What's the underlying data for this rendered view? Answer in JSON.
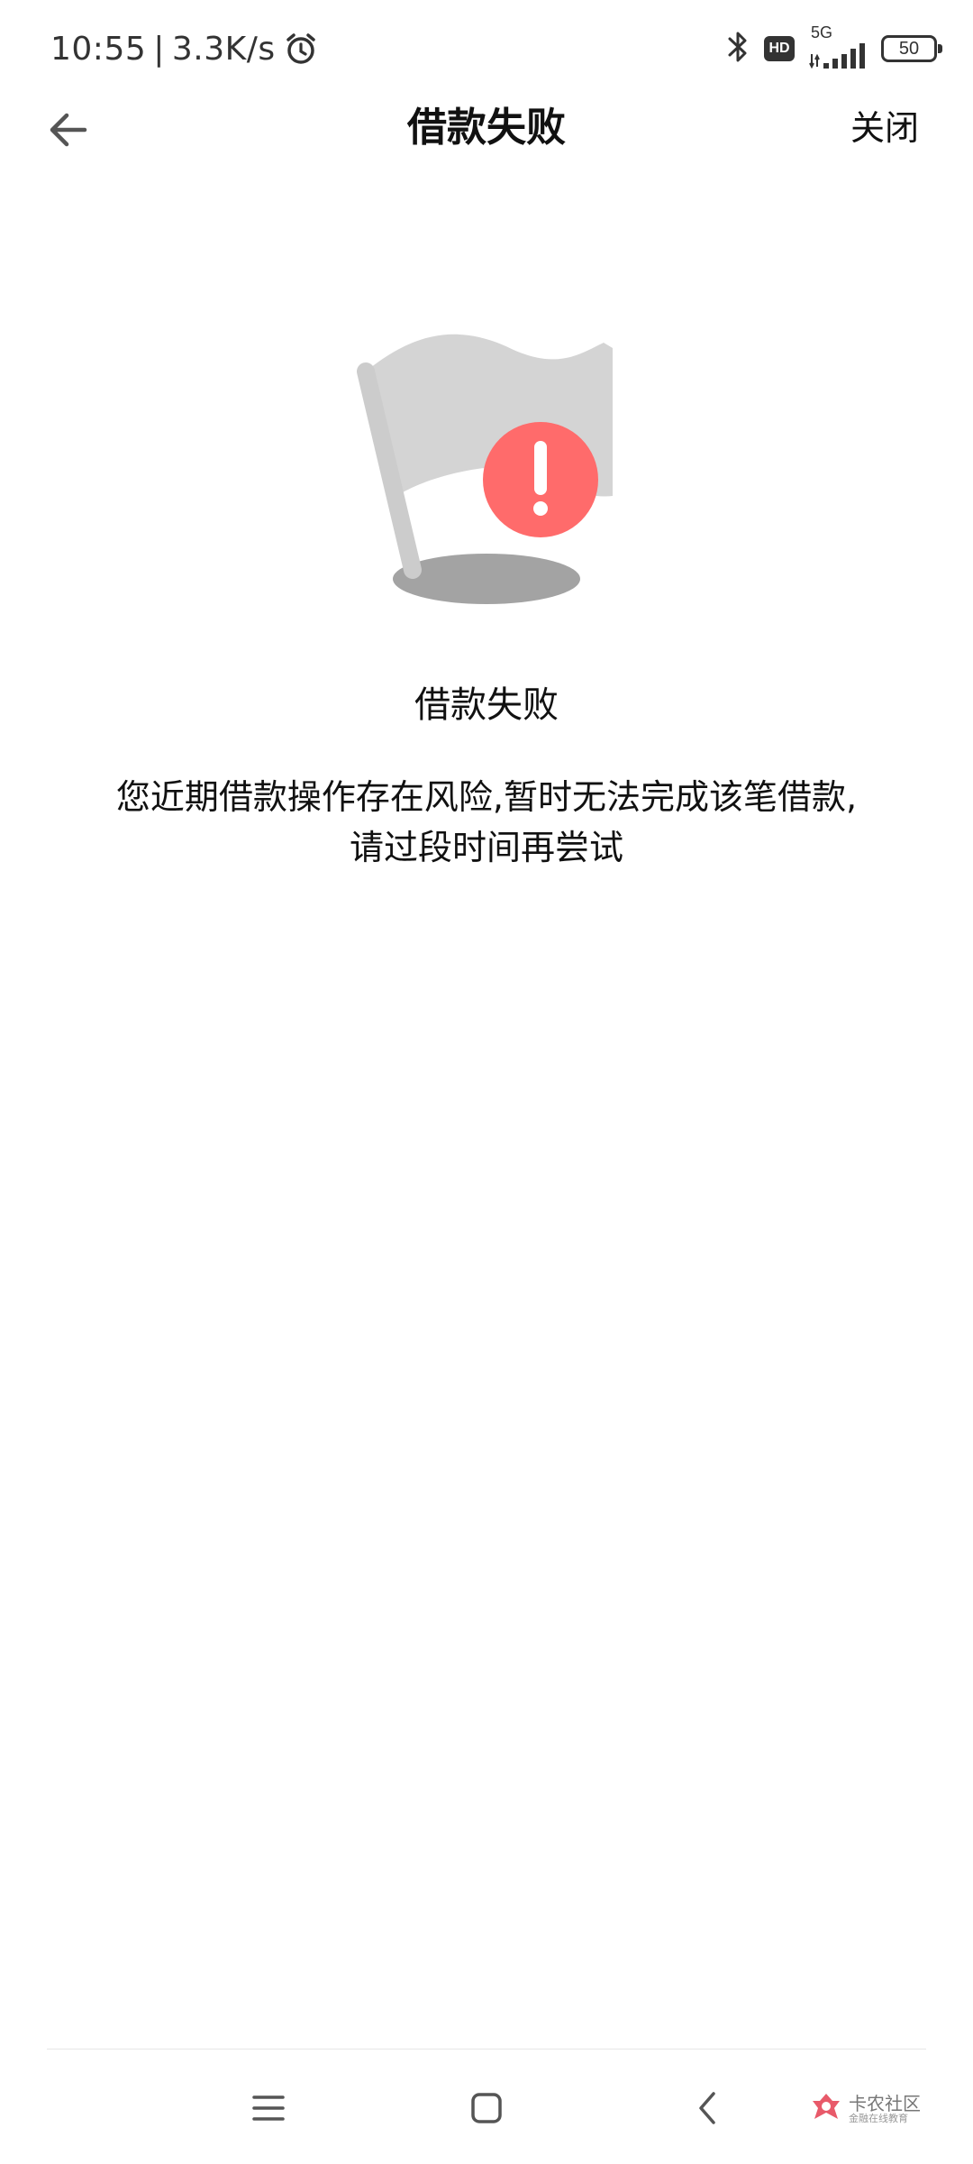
{
  "status_bar": {
    "time": "10:55",
    "separator": "|",
    "net_speed": "3.3K/s",
    "network_type": "5G",
    "hd_label": "HD",
    "battery_level": "50",
    "icons": [
      "alarm-icon",
      "bluetooth-icon",
      "hd-icon",
      "signal-icon",
      "battery-icon"
    ]
  },
  "header": {
    "title": "借款失败",
    "close_label": "关闭",
    "back_icon": "back-arrow-icon"
  },
  "result": {
    "icon": "failure-flag-icon",
    "accent_color": "#ff6b6b",
    "title": "借款失败",
    "message_line1": "您近期借款操作存在风险,暂时无法完成该笔借款,",
    "message_line2": "请过段时间再尝试"
  },
  "system_nav": {
    "icons": [
      "menu-icon",
      "home-icon",
      "back-icon"
    ]
  },
  "watermark": {
    "main": "卡农社区",
    "sub": "金融在线教育"
  }
}
